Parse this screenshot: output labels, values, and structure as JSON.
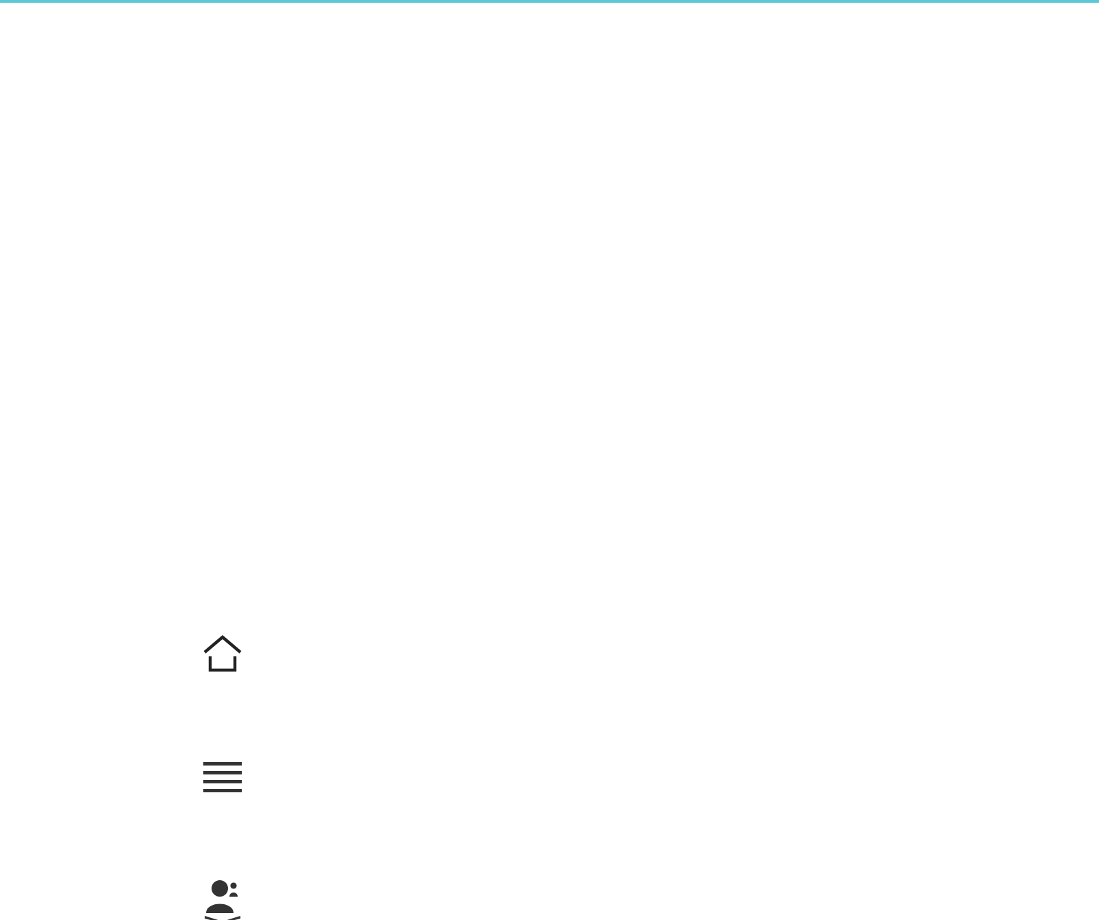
{
  "nav": [
    {
      "kind": "home"
    },
    {
      "kind": "list"
    },
    {
      "kind": "contacts"
    }
  ]
}
